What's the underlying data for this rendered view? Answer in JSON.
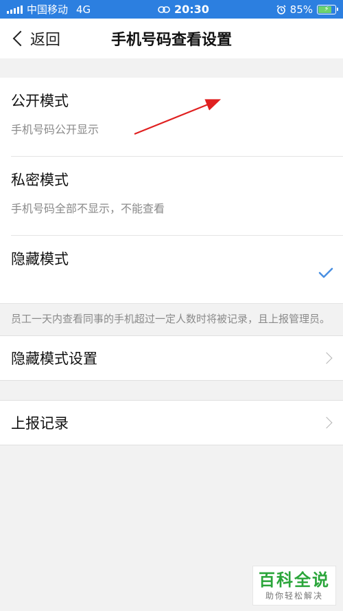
{
  "status_bar": {
    "carrier": "中国移动",
    "network": "4G",
    "time": "20:30",
    "battery": "85%",
    "battery_level": 0.85
  },
  "nav": {
    "back_label": "返回",
    "title": "手机号码查看设置"
  },
  "modes": [
    {
      "title": "公开模式",
      "subtitle": "手机号码公开显示",
      "selected": false
    },
    {
      "title": "私密模式",
      "subtitle": "手机号码全部不显示，不能查看",
      "selected": false
    },
    {
      "title": "隐藏模式",
      "subtitle": "",
      "selected": true
    }
  ],
  "note": "员工一天内查看同事的手机超过一定人数时将被记录，且上报管理员。",
  "rows": {
    "hidden_settings": "隐藏模式设置",
    "report_log": "上报记录"
  },
  "watermark": {
    "title": "百科全说",
    "subtitle": "助你轻松解决"
  },
  "colors": {
    "status_bar": "#2c7fe0",
    "check": "#4a90e2",
    "annotation_arrow": "#e02020",
    "watermark_green": "#2aa53a"
  }
}
